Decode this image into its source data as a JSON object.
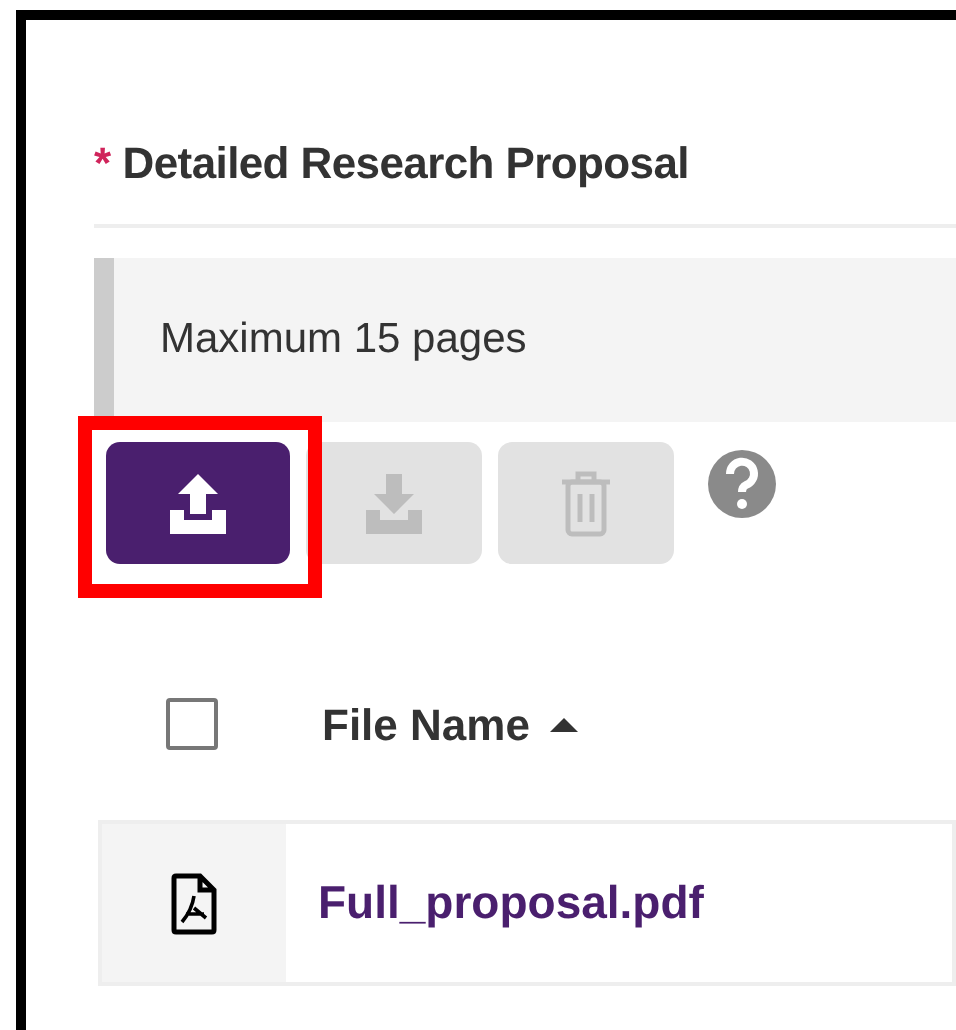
{
  "section": {
    "required_mark": "*",
    "title": "Detailed Research Proposal"
  },
  "note": "Maximum 15 pages",
  "toolbar": [
    {
      "kind": "upload",
      "disabled": false,
      "highlighted": true
    },
    {
      "kind": "download",
      "disabled": true,
      "highlighted": false
    },
    {
      "kind": "delete",
      "disabled": true,
      "highlighted": false
    },
    {
      "kind": "help",
      "disabled": false,
      "highlighted": false
    }
  ],
  "table": {
    "select_all": {
      "checked": false
    },
    "columns": [
      {
        "label": "File Name",
        "sort_ascending": true
      }
    ],
    "rows": [
      {
        "kind": "pdf",
        "name": "Full_proposal.pdf"
      }
    ]
  }
}
